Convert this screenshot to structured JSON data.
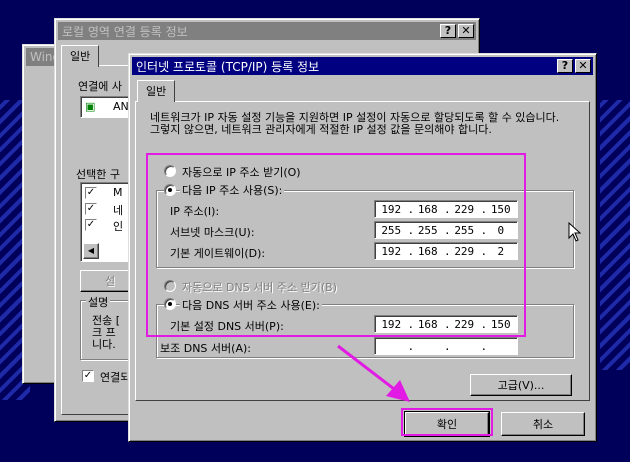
{
  "desktop": {
    "back_window_title": "Wind"
  },
  "local_window": {
    "title": "로컬 영역 연결 등록 정보",
    "help_glyph": "?",
    "close_glyph": "✕",
    "tab_general": "일반",
    "connect_label": "연결에 사",
    "adapter_text": "AN",
    "components_label": "선택한 구",
    "components": [
      {
        "label": "M",
        "checked": true
      },
      {
        "label": "네",
        "checked": true
      },
      {
        "label": "인",
        "checked": true
      }
    ],
    "scroll_left_glyph": "◀",
    "install_button": "설",
    "desc_group_label": "설명",
    "desc_lines": [
      "전송 [",
      "크 프",
      "니다."
    ],
    "show_icon_label": "연결되"
  },
  "tcp_dialog": {
    "title": "인터넷 프로토콜 (TCP/IP) 등록 정보",
    "help_glyph": "?",
    "close_glyph": "✕",
    "tab_general": "일반",
    "info_text": "네트워크가 IP 자동 설정 기능을 지원하면 IP 설정이 자동으로 할당되도록 할 수 있습니다. 그렇지 않으면, 네트워크 관리자에게 적절한 IP 설정 값을 문의해야 합니다.",
    "auto_ip_label": "자동으로 IP 주소 받기(O)",
    "use_ip_label": "다음 IP 주소 사용(S):",
    "ip_address_label": "IP 주소(I):",
    "ip_address": [
      "192",
      "168",
      "229",
      "150"
    ],
    "subnet_label": "서브넷 마스크(U):",
    "subnet": [
      "255",
      "255",
      "255",
      "0"
    ],
    "gateway_label": "기본 게이트웨이(D):",
    "gateway": [
      "192",
      "168",
      "229",
      "2"
    ],
    "auto_dns_label": "자동으로 DNS 서버 주소 받기(B)",
    "use_dns_label": "다음 DNS 서버 주소 사용(E):",
    "preferred_dns_label": "기본 설정 DNS 서버(P):",
    "preferred_dns": [
      "192",
      "168",
      "229",
      "150"
    ],
    "alternate_dns_label": "보조 DNS 서버(A):",
    "alternate_dns": [
      "",
      "",
      "",
      ""
    ],
    "advanced_button": "고급(V)...",
    "ok_button": "확인",
    "cancel_button": "취소",
    "dot": "."
  },
  "colors": {
    "annotation": "#e21be4",
    "titlebar_active": "#000080",
    "desktop": "#00005a"
  }
}
